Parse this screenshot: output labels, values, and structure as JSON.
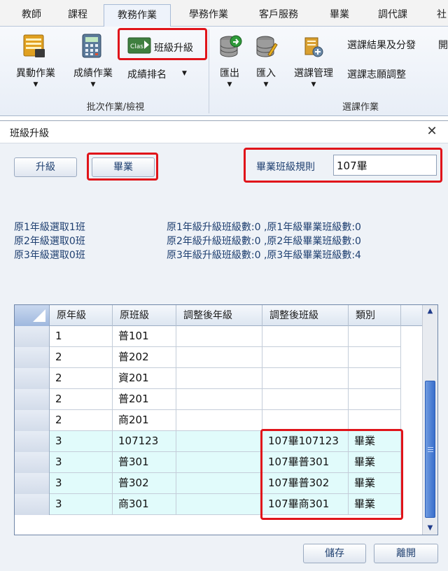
{
  "tabs": [
    "教師",
    "課程",
    "教務作業",
    "學務作業",
    "客戶服務",
    "畢業",
    "調代課",
    "社"
  ],
  "active_tab": "教務作業",
  "ribbon": {
    "batch_group": {
      "label": "批次作業/檢視",
      "transfer": "異動作業",
      "grades": "成績作業",
      "promote": "班級升級",
      "ranking": "成績排名"
    },
    "course_group": {
      "label": "選課作業",
      "export": "匯出",
      "import": "匯入",
      "manage": "選課管理",
      "result": "選課結果及分發",
      "adjust": "選課志願調整",
      "cut": "開"
    },
    "icon_text": "Clas"
  },
  "dialog": {
    "title": "班級升級",
    "promote_button": "升級",
    "graduate_button": "畢業",
    "rule_label": "畢業班級規則",
    "rule_value": "107畢",
    "selection_lines": [
      "原1年級選取1班",
      "原2年級選取0班",
      "原3年級選取0班"
    ],
    "count_lines": [
      "原1年級升級班級數:0 ,原1年級畢業班級數:0",
      "原2年級升級班級數:0 ,原2年級畢業班級數:0",
      "原3年級升級班級數:0 ,原3年級畢業班級數:4"
    ],
    "save_button": "儲存",
    "leave_button": "離開"
  },
  "grid": {
    "columns": [
      "原年級",
      "原班級",
      "調整後年級",
      "調整後班級",
      "類別"
    ],
    "rows": [
      {
        "grade": "1",
        "cls": "普101",
        "new_grade": "",
        "new_cls": "",
        "type": ""
      },
      {
        "grade": "2",
        "cls": "普202",
        "new_grade": "",
        "new_cls": "",
        "type": ""
      },
      {
        "grade": "2",
        "cls": "資201",
        "new_grade": "",
        "new_cls": "",
        "type": ""
      },
      {
        "grade": "2",
        "cls": "普201",
        "new_grade": "",
        "new_cls": "",
        "type": ""
      },
      {
        "grade": "2",
        "cls": "商201",
        "new_grade": "",
        "new_cls": "",
        "type": ""
      },
      {
        "grade": "3",
        "cls": "107123",
        "new_grade": "",
        "new_cls": "107畢107123",
        "type": "畢業"
      },
      {
        "grade": "3",
        "cls": "普301",
        "new_grade": "",
        "new_cls": "107畢普301",
        "type": "畢業"
      },
      {
        "grade": "3",
        "cls": "普302",
        "new_grade": "",
        "new_cls": "107畢普302",
        "type": "畢業"
      },
      {
        "grade": "3",
        "cls": "商301",
        "new_grade": "",
        "new_cls": "107畢商301",
        "type": "畢業"
      }
    ]
  },
  "colors": {
    "highlight": "#e0141a",
    "graduate_row": "#e1fbfb",
    "accent_text": "#1e3f70"
  }
}
